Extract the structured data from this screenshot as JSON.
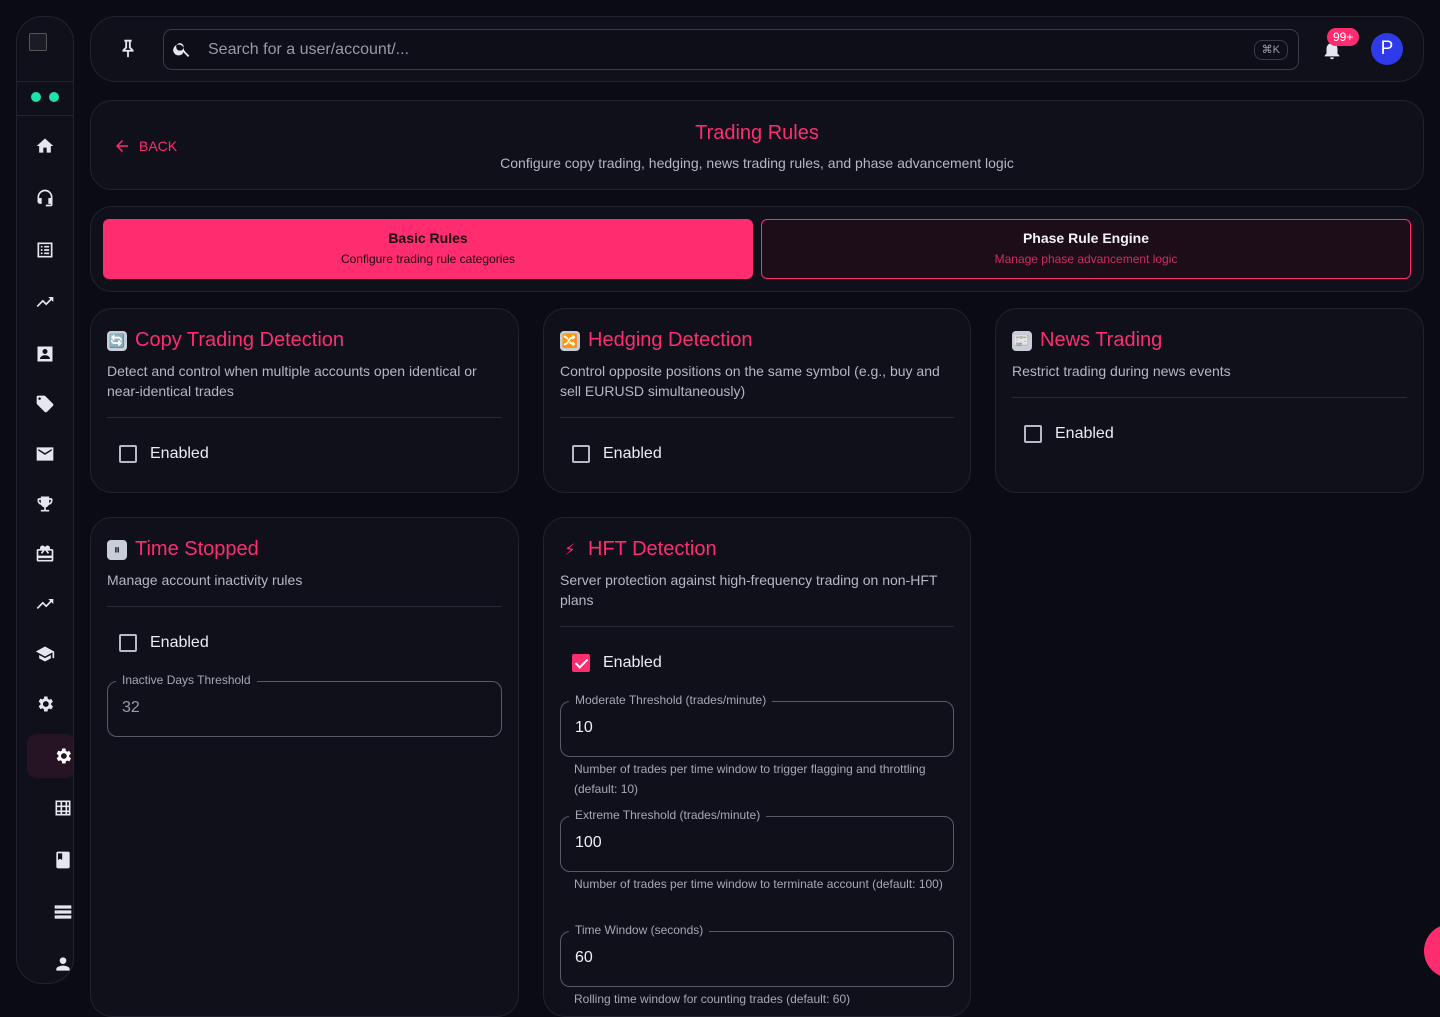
{
  "search": {
    "placeholder": "Search for a user/account/...",
    "shortcut": "⌘K"
  },
  "notifications": {
    "count": "99+"
  },
  "user": {
    "initial": "P"
  },
  "header": {
    "back_label": "BACK",
    "title": "Trading Rules",
    "subtitle": "Configure copy trading, hedging, news trading rules, and phase advancement logic"
  },
  "tabs": [
    {
      "title": "Basic Rules",
      "subtitle": "Configure trading rule categories",
      "active": true
    },
    {
      "title": "Phase Rule Engine",
      "subtitle": "Manage phase advancement logic",
      "active": false
    }
  ],
  "rules": {
    "copy": {
      "icon": "🔄",
      "title": "Copy Trading Detection",
      "description": "Detect and control when multiple accounts open identical or near-identical trades",
      "enabled_label": "Enabled",
      "enabled": false
    },
    "hedging": {
      "icon": "🔀",
      "title": "Hedging Detection",
      "description": "Control opposite positions on the same symbol (e.g., buy and sell EURUSD simultaneously)",
      "enabled_label": "Enabled",
      "enabled": false
    },
    "news": {
      "icon": "📰",
      "title": "News Trading",
      "description": "Restrict trading during news events",
      "enabled_label": "Enabled",
      "enabled": false
    },
    "time": {
      "icon": "⏸",
      "title": "Time Stopped",
      "description": "Manage account inactivity rules",
      "enabled_label": "Enabled",
      "enabled": false,
      "inactive_label": "Inactive Days Threshold",
      "inactive_value": "32"
    },
    "hft": {
      "icon": "⚡",
      "title": "HFT Detection",
      "description": "Server protection against high-frequency trading on non-HFT plans",
      "enabled_label": "Enabled",
      "enabled": true,
      "moderate_label": "Moderate Threshold (trades/minute)",
      "moderate_value": "10",
      "moderate_help": "Number of trades per time window to trigger flagging and throttling (default: 10)",
      "extreme_label": "Extreme Threshold (trades/minute)",
      "extreme_value": "100",
      "extreme_help": "Number of trades per time window to terminate account (default: 100)",
      "window_label": "Time Window (seconds)",
      "window_value": "60",
      "window_help": "Rolling time window for counting trades (default: 60)"
    }
  },
  "colors": {
    "accent": "#ff2d6f",
    "status": "#1ee3a8",
    "avatar": "#2f3ae8"
  }
}
